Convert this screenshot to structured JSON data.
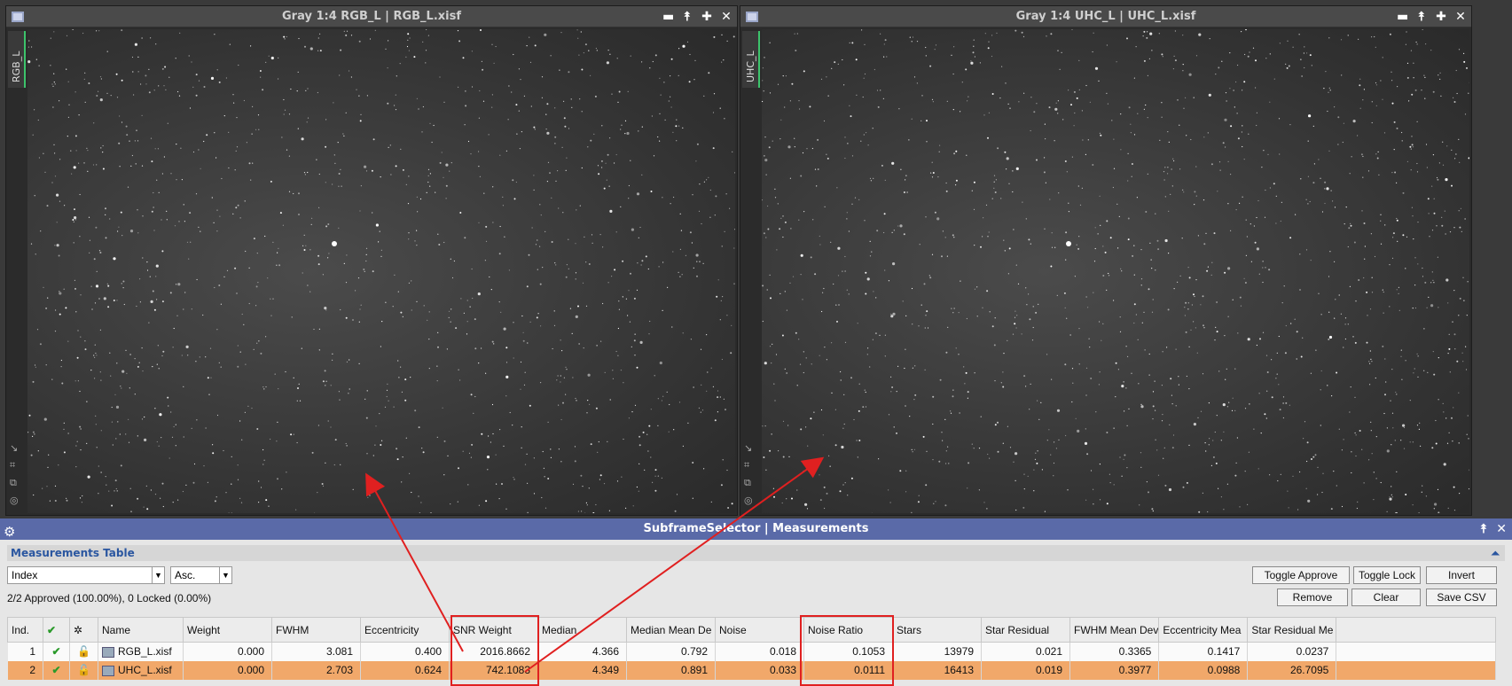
{
  "window_left": {
    "title": "Gray 1:4 RGB_L | RGB_L.xisf",
    "side_tab": "RGB_L"
  },
  "window_right": {
    "title": "Gray 1:4 UHC_L | UHC_L.xisf",
    "side_tab": "UHC_L"
  },
  "window_controls": {
    "minimize": "▬",
    "shade": "⯭",
    "maximize": "✚",
    "close": "✕"
  },
  "panel": {
    "title": "SubframeSelector | Measurements",
    "section": "Measurements Table",
    "sort_field": "Index",
    "sort_order": "Asc.",
    "status": "2/2 Approved (100.00%), 0 Locked (0.00%)",
    "buttons": {
      "toggle_approve": "Toggle Approve",
      "toggle_lock": "Toggle Lock",
      "invert": "Invert",
      "remove": "Remove",
      "clear": "Clear",
      "save_csv": "Save CSV"
    }
  },
  "table": {
    "headers": [
      "Ind.",
      "",
      "",
      "Name",
      "Weight",
      "FWHM",
      "Eccentricity",
      "SNR Weight",
      "Median",
      "Median Mean De",
      "Noise",
      "Noise Ratio",
      "Stars",
      "Star Residual",
      "FWHM Mean Dev",
      "Eccentricity Mea",
      "Star Residual Me"
    ],
    "rows": [
      {
        "index": "1",
        "name": "RGB_L.xisf",
        "weight": "0.000",
        "fwhm": "3.081",
        "eccentricity": "0.400",
        "snr_weight": "2016.8662",
        "median": "4.366",
        "median_mean_dev": "0.792",
        "noise": "0.018",
        "noise_ratio": "0.1053",
        "stars": "13979",
        "star_residual": "0.021",
        "fwhm_mean_dev": "0.3365",
        "eccentricity_mean_dev": "0.1417",
        "star_residual_mean_dev": "0.0237"
      },
      {
        "index": "2",
        "name": "UHC_L.xisf",
        "weight": "0.000",
        "fwhm": "2.703",
        "eccentricity": "0.624",
        "snr_weight": "742.1083",
        "median": "4.349",
        "median_mean_dev": "0.891",
        "noise": "0.033",
        "noise_ratio": "0.0111",
        "stars": "16413",
        "star_residual": "0.019",
        "fwhm_mean_dev": "0.3977",
        "eccentricity_mean_dev": "0.0988",
        "star_residual_mean_dev": "26.7095"
      }
    ]
  },
  "colors": {
    "highlight": "#e02020",
    "selected_row": "#f1a86a",
    "panel_title": "#5a6aa8"
  }
}
